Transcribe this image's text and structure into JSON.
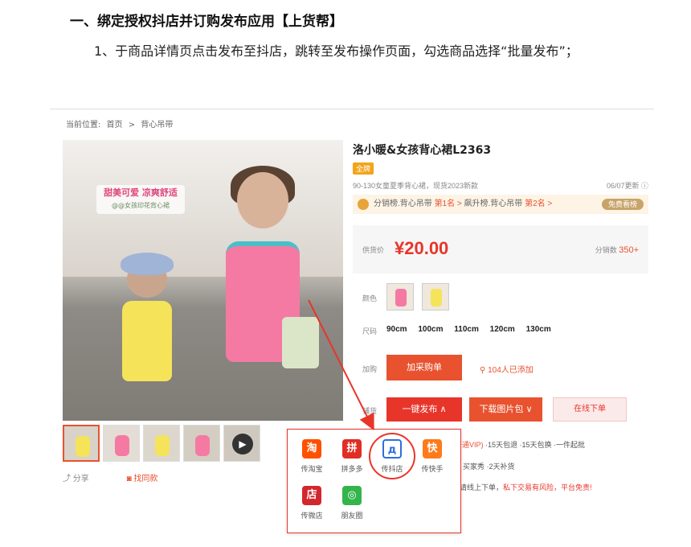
{
  "doc": {
    "heading": "一、绑定授权抖店并订购发布应用【上货帮】",
    "step": "1、于商品详情页点击发布至抖店，跳转至发布操作页面，勾选商品选择“批量发布”；"
  },
  "breadcrumb": {
    "label": "当前位置:",
    "home": "首页",
    "sep": ">",
    "category": "背心吊带"
  },
  "gallery": {
    "slogan": "甜美可爱 凉爽舒适",
    "slogan_sub": "@@女孩印花背心裙",
    "share": "分享",
    "collect": "找同款"
  },
  "product": {
    "title": "洛小暖&女孩背心裙L2363",
    "badge": "全牌",
    "desc": "90-130女童夏季背心裙，现货2023新款",
    "updated": "06/07更新",
    "rank_text_1": "分销榜.背心吊带",
    "rank_1": "第1名 >",
    "rank_text_2": "飙升榜.背心吊带",
    "rank_2": "第2名 >",
    "rank_button": "免费看榜",
    "price_label": "供货价",
    "price": "¥20.00",
    "sold_label": "分销数",
    "sold_value": "350+",
    "color_label": "颜色",
    "size_label": "尺码",
    "sizes": [
      "90cm",
      "100cm",
      "110cm",
      "120cm",
      "130cm"
    ],
    "purchase_label": "加购",
    "add_cart": "加采购单",
    "added_count": "104人已添加",
    "supply_label": "铺货",
    "publish": "一键发布",
    "download": "下载图片包",
    "order": "在线下单",
    "services_1_red": "开通VIP)",
    "services_1": "·15天包退  ·15天包换  ·一件起批",
    "services_2": "买家秀  ·2天补货",
    "services_3_prefix": "请线上下单，",
    "services_3_red": "私下交易有风险，平台免责!"
  },
  "publish_menu": {
    "items": [
      {
        "label": "传淘宝",
        "glyph": "淘",
        "color": "#ff5000"
      },
      {
        "label": "拼多多",
        "glyph": "拼",
        "color": "#e02e24"
      },
      {
        "label": "传抖店",
        "glyph": "д",
        "color": "#2f6fe0"
      },
      {
        "label": "传快手",
        "glyph": "快",
        "color": "#ff7a1a"
      },
      {
        "label": "传微店",
        "glyph": "店",
        "color": "#d3272e"
      },
      {
        "label": "朋友圈",
        "glyph": "◎",
        "color": "#34b44a"
      }
    ]
  }
}
